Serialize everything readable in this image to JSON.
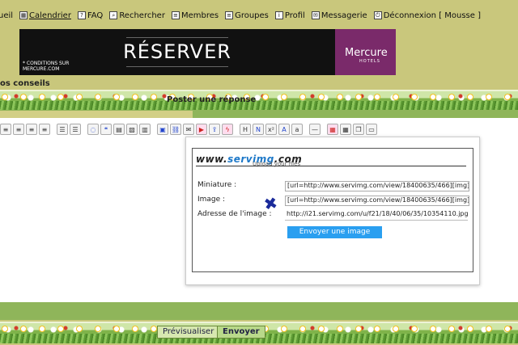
{
  "nav": {
    "items": [
      {
        "label": "ueil",
        "icon": "home-icon"
      },
      {
        "label": "Calendrier",
        "icon": "calendar-icon"
      },
      {
        "label": "FAQ",
        "icon": "faq-icon"
      },
      {
        "label": "Rechercher",
        "icon": "search-icon"
      },
      {
        "label": "Membres",
        "icon": "members-icon"
      },
      {
        "label": "Groupes",
        "icon": "groups-icon"
      },
      {
        "label": "Profil",
        "icon": "profile-icon"
      },
      {
        "label": "Messagerie",
        "icon": "mail-icon"
      },
      {
        "label": "Déconnexion [ Mousse ]",
        "icon": "logout-icon"
      }
    ]
  },
  "banner": {
    "cta": "RÉSERVER",
    "conditions": "* CONDITIONS SUR MERCURE.COM",
    "brand": "Mercure",
    "brand_sub": "HOTELS"
  },
  "section_title": "os conseils",
  "post_title": "Poster une réponse",
  "toolbar": {
    "icons": [
      "align-left-icon",
      "align-center-icon",
      "align-right-icon",
      "justify-icon",
      "list-bullet-icon",
      "list-number-icon",
      "comment-icon",
      "quote-icon",
      "code-icon",
      "spoiler-icon",
      "hide-icon",
      "image-icon",
      "link-icon",
      "email-icon",
      "youtube-icon",
      "upload-icon",
      "flash-icon",
      "h-icon",
      "strike-icon",
      "sup-icon",
      "sub-icon",
      "font-icon",
      "hr-icon",
      "date-icon",
      "table-icon",
      "copy-icon",
      "paste-icon"
    ]
  },
  "servimg": {
    "logo_prefix": "www.",
    "logo_main": "servimg",
    "logo_suffix": ".com",
    "tagline": "Upload your files",
    "rows": [
      {
        "label": "Miniature :",
        "value": "[url=http://www.servimg.com/view/18400635/466][img]http"
      },
      {
        "label": "Image :",
        "value": "[url=http://www.servimg.com/view/18400635/466][img]http"
      },
      {
        "label": "Adresse de l'image :",
        "value": "http://i21.servimg.com/u/f21/18/40/06/35/10354110.jpg"
      }
    ],
    "send_label": "Envoyer une image"
  },
  "buttons": {
    "preview": "Prévisualiser",
    "send": "Envoyer"
  }
}
